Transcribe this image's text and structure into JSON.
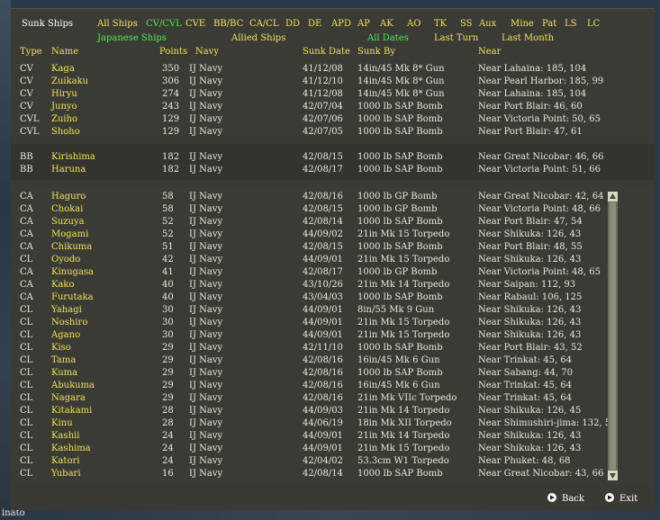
{
  "window": {
    "title": "Sunk Ships"
  },
  "filters": {
    "row1": [
      "All Ships",
      "CV/CVL",
      "CVE",
      "BB/BC",
      "CA/CL",
      "DD",
      "DE",
      "APD",
      "AP",
      "AK",
      "AO",
      "TK",
      "SS",
      "Aux",
      "Mine",
      "Pat",
      "LS",
      "LC"
    ],
    "row2": [
      "Japanese Ships",
      "Allied Ships",
      "All Dates",
      "Last Turn",
      "Last Month"
    ]
  },
  "columns": [
    "Type",
    "Name",
    "Points",
    "Navy",
    "Sunk Date",
    "Sunk By",
    "Near"
  ],
  "groups": [
    {
      "rows": [
        {
          "type": "CV",
          "name": "Kaga",
          "points": "350",
          "navy": "IJ Navy",
          "date": "41/12/08",
          "by": "14in/45 Mk 8* Gun",
          "near": "Near Lahaina: 185, 104"
        },
        {
          "type": "CV",
          "name": "Zuikaku",
          "points": "306",
          "navy": "IJ Navy",
          "date": "41/12/10",
          "by": "14in/45 Mk 8* Gun",
          "near": "Near Pearl Harbor: 185, 99"
        },
        {
          "type": "CV",
          "name": "Hiryu",
          "points": "274",
          "navy": "IJ Navy",
          "date": "41/12/08",
          "by": "14in/45 Mk 8* Gun",
          "near": "Near Lahaina: 185, 104"
        },
        {
          "type": "CV",
          "name": "Junyo",
          "points": "243",
          "navy": "IJ Navy",
          "date": "42/07/04",
          "by": "1000 lb SAP Bomb",
          "near": "Near Port Blair: 46, 60"
        },
        {
          "type": "CVL",
          "name": "Zuiho",
          "points": "129",
          "navy": "IJ Navy",
          "date": "42/07/06",
          "by": "1000 lb SAP Bomb",
          "near": "Near Victoria Point: 50, 65"
        },
        {
          "type": "CVL",
          "name": "Shoho",
          "points": "129",
          "navy": "IJ Navy",
          "date": "42/07/05",
          "by": "1000 lb SAP Bomb",
          "near": "Near Port Blair: 47, 61"
        }
      ]
    },
    {
      "rows": [
        {
          "type": "BB",
          "name": "Kirishima",
          "points": "182",
          "navy": "IJ Navy",
          "date": "42/08/15",
          "by": "1000 lb SAP Bomb",
          "near": "Near Great Nicobar: 46, 66"
        },
        {
          "type": "BB",
          "name": "Haruna",
          "points": "182",
          "navy": "IJ Navy",
          "date": "42/08/17",
          "by": "1000 lb SAP Bomb",
          "near": "Near Victoria Point: 51, 66"
        }
      ]
    },
    {
      "rows": [
        {
          "type": "CA",
          "name": "Haguro",
          "points": "58",
          "navy": "IJ Navy",
          "date": "42/08/16",
          "by": "1000 lb GP Bomb",
          "near": "Near Great Nicobar: 42, 64"
        },
        {
          "type": "CA",
          "name": "Chokai",
          "points": "58",
          "navy": "IJ Navy",
          "date": "42/08/15",
          "by": "1000 lb GP Bomb",
          "near": "Near Victoria Point: 48, 66"
        },
        {
          "type": "CA",
          "name": "Suzuya",
          "points": "52",
          "navy": "IJ Navy",
          "date": "42/08/14",
          "by": "1000 lb SAP Bomb",
          "near": "Near Port Blair: 47, 54"
        },
        {
          "type": "CA",
          "name": "Mogami",
          "points": "52",
          "navy": "IJ Navy",
          "date": "44/09/02",
          "by": "21in Mk 15 Torpedo",
          "near": "Near Shikuka: 126, 43"
        },
        {
          "type": "CA",
          "name": "Chikuma",
          "points": "51",
          "navy": "IJ Navy",
          "date": "42/08/15",
          "by": "1000 lb SAP Bomb",
          "near": "Near Port Blair: 48, 55"
        },
        {
          "type": "CL",
          "name": "Oyodo",
          "points": "42",
          "navy": "IJ Navy",
          "date": "44/09/01",
          "by": "21in Mk 15 Torpedo",
          "near": "Near Shikuka: 126, 43"
        },
        {
          "type": "CA",
          "name": "Kinugasa",
          "points": "41",
          "navy": "IJ Navy",
          "date": "42/08/17",
          "by": "1000 lb GP Bomb",
          "near": "Near Victoria Point: 48, 65"
        },
        {
          "type": "CA",
          "name": "Kako",
          "points": "40",
          "navy": "IJ Navy",
          "date": "43/10/26",
          "by": "21in Mk 14 Torpedo",
          "near": "Near Saipan: 112, 93"
        },
        {
          "type": "CA",
          "name": "Furutaka",
          "points": "40",
          "navy": "IJ Navy",
          "date": "43/04/03",
          "by": "1000 lb SAP Bomb",
          "near": "Near Rabaul: 106, 125"
        },
        {
          "type": "CL",
          "name": "Yahagi",
          "points": "30",
          "navy": "IJ Navy",
          "date": "44/09/01",
          "by": "8in/55 Mk 9 Gun",
          "near": "Near Shikuka: 126, 43"
        },
        {
          "type": "CL",
          "name": "Noshiro",
          "points": "30",
          "navy": "IJ Navy",
          "date": "44/09/01",
          "by": "21in Mk 15 Torpedo",
          "near": "Near Shikuka: 126, 43"
        },
        {
          "type": "CL",
          "name": "Agano",
          "points": "30",
          "navy": "IJ Navy",
          "date": "44/09/01",
          "by": "21in Mk 15 Torpedo",
          "near": "Near Shikuka: 126, 43"
        },
        {
          "type": "CL",
          "name": "Kiso",
          "points": "29",
          "navy": "IJ Navy",
          "date": "42/11/10",
          "by": "1000 lb SAP Bomb",
          "near": "Near Port Blair: 43, 52"
        },
        {
          "type": "CL",
          "name": "Tama",
          "points": "29",
          "navy": "IJ Navy",
          "date": "42/08/16",
          "by": "16in/45 Mk 6 Gun",
          "near": "Near Trinkat: 45, 64"
        },
        {
          "type": "CL",
          "name": "Kuma",
          "points": "29",
          "navy": "IJ Navy",
          "date": "42/08/16",
          "by": "1000 lb SAP Bomb",
          "near": "Near Sabang: 44, 70"
        },
        {
          "type": "CL",
          "name": "Abukuma",
          "points": "29",
          "navy": "IJ Navy",
          "date": "42/08/16",
          "by": "16in/45 Mk 6 Gun",
          "near": "Near Trinkat: 45, 64"
        },
        {
          "type": "CL",
          "name": "Nagara",
          "points": "29",
          "navy": "IJ Navy",
          "date": "42/08/16",
          "by": "21in Mk VIIc Torpedo",
          "near": "Near Trinkat: 45, 64"
        },
        {
          "type": "CL",
          "name": "Kitakami",
          "points": "28",
          "navy": "IJ Navy",
          "date": "44/09/03",
          "by": "21in Mk 14 Torpedo",
          "near": "Near Shikuka: 126, 45"
        },
        {
          "type": "CL",
          "name": "Kinu",
          "points": "28",
          "navy": "IJ Navy",
          "date": "44/06/19",
          "by": "18in Mk XII Torpedo",
          "near": "Near Shimushiri-jima: 132, 51"
        },
        {
          "type": "CL",
          "name": "Kashii",
          "points": "24",
          "navy": "IJ Navy",
          "date": "44/09/01",
          "by": "21in Mk 14 Torpedo",
          "near": "Near Shikuka: 126, 43"
        },
        {
          "type": "CL",
          "name": "Kashima",
          "points": "24",
          "navy": "IJ Navy",
          "date": "44/09/01",
          "by": "21in Mk 15 Torpedo",
          "near": "Near Shikuka: 126, 43"
        },
        {
          "type": "CL",
          "name": "Katori",
          "points": "24",
          "navy": "IJ Navy",
          "date": "42/04/02",
          "by": "53.3cm W1 Torpedo",
          "near": "Near Phuket: 48, 68"
        },
        {
          "type": "CL",
          "name": "Yubari",
          "points": "16",
          "navy": "IJ Navy",
          "date": "42/08/14",
          "by": "1000 lb SAP Bomb",
          "near": "Near Great Nicobar: 43, 66"
        }
      ]
    }
  ],
  "footer": {
    "back": "Back",
    "exit": "Exit"
  },
  "map": {
    "bottom_text": "inato"
  },
  "colors": {
    "panel": "#3a3a35",
    "highlight": "#f1e15a",
    "selected": "#4ee84e",
    "text": "#e8e8d8"
  }
}
